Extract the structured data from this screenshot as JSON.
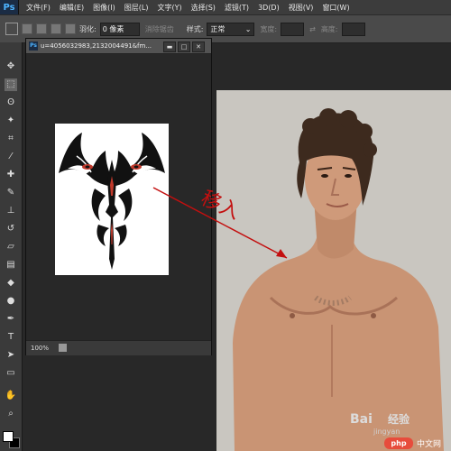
{
  "app": {
    "logo": "Ps"
  },
  "menubar": {
    "items": [
      "文件(F)",
      "编辑(E)",
      "图像(I)",
      "图层(L)",
      "文字(Y)",
      "选择(S)",
      "滤镜(T)",
      "3D(D)",
      "视图(V)",
      "窗口(W)"
    ]
  },
  "options": {
    "feather_label": "羽化:",
    "feather_value": "0 像素",
    "antialias_label": "消除锯齿",
    "style_label": "样式:",
    "style_value": "正常",
    "width_label": "宽度:",
    "height_label": "高度:"
  },
  "document": {
    "title": "u=4056032983,2132004491&fm...",
    "min_glyph": "▬",
    "max_glyph": "□",
    "close_glyph": "✕",
    "zoom": "100%"
  },
  "annotation": {
    "text": "移入",
    "color": "#c30f0f"
  },
  "watermark": {
    "logo": "Bai",
    "brand": "经验",
    "sub": "jingyan",
    "badge": "php",
    "site": "中文网"
  },
  "colors": {
    "foreground": "#ffffff",
    "background": "#000000"
  }
}
